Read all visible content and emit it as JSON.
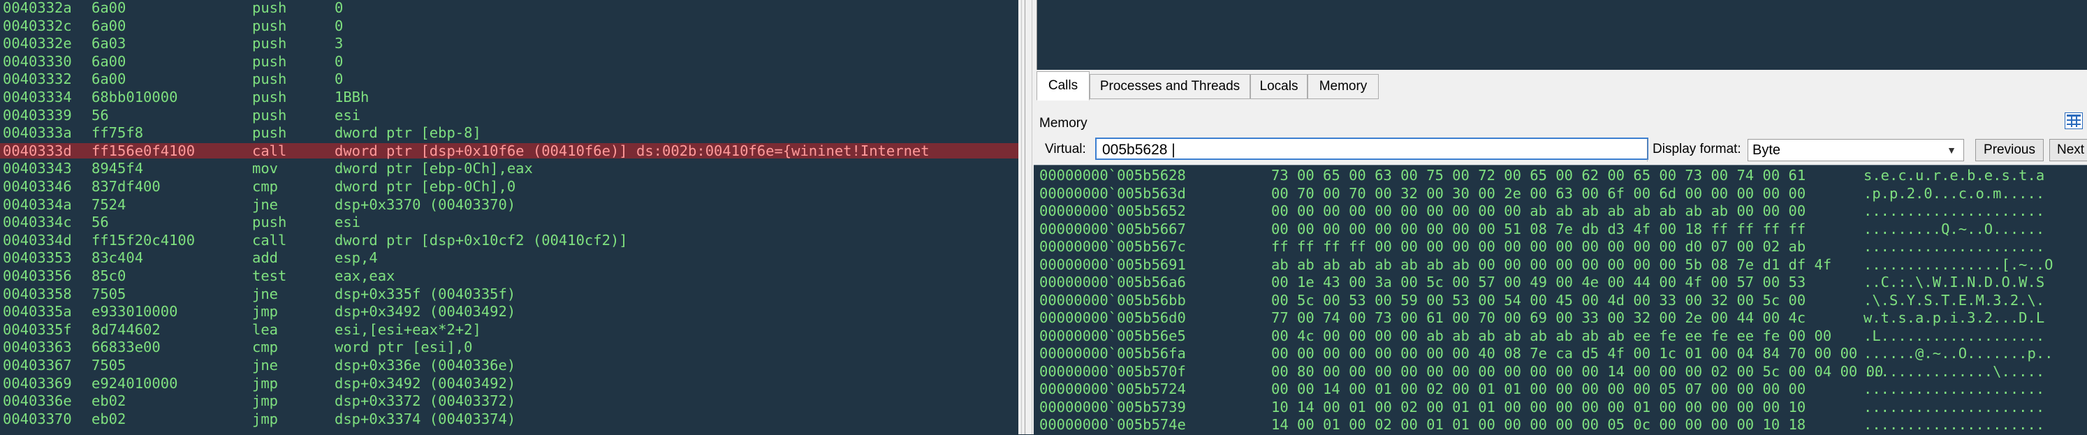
{
  "disassembly": {
    "rows": [
      {
        "addr": "0040332a",
        "bytes": "6a00",
        "mnemonic": "push",
        "operands": "0"
      },
      {
        "addr": "0040332c",
        "bytes": "6a00",
        "mnemonic": "push",
        "operands": "0"
      },
      {
        "addr": "0040332e",
        "bytes": "6a03",
        "mnemonic": "push",
        "operands": "3"
      },
      {
        "addr": "00403330",
        "bytes": "6a00",
        "mnemonic": "push",
        "operands": "0"
      },
      {
        "addr": "00403332",
        "bytes": "6a00",
        "mnemonic": "push",
        "operands": "0"
      },
      {
        "addr": "00403334",
        "bytes": "68bb010000",
        "mnemonic": "push",
        "operands": "1BBh"
      },
      {
        "addr": "00403339",
        "bytes": "56",
        "mnemonic": "push",
        "operands": "esi"
      },
      {
        "addr": "0040333a",
        "bytes": "ff75f8",
        "mnemonic": "push",
        "operands": "dword ptr [ebp-8]"
      },
      {
        "addr": "0040333d",
        "bytes": "ff156e0f4100",
        "mnemonic": "call",
        "operands": "dword ptr [dsp+0x10f6e (00410f6e)] ds:002b:00410f6e={wininet!Internet",
        "highlighted": true
      },
      {
        "addr": "00403343",
        "bytes": "8945f4",
        "mnemonic": "mov",
        "operands": "dword ptr [ebp-0Ch],eax"
      },
      {
        "addr": "00403346",
        "bytes": "837df400",
        "mnemonic": "cmp",
        "operands": "dword ptr [ebp-0Ch],0"
      },
      {
        "addr": "0040334a",
        "bytes": "7524",
        "mnemonic": "jne",
        "operands": "dsp+0x3370 (00403370)"
      },
      {
        "addr": "0040334c",
        "bytes": "56",
        "mnemonic": "push",
        "operands": "esi"
      },
      {
        "addr": "0040334d",
        "bytes": "ff15f20c4100",
        "mnemonic": "call",
        "operands": "dword ptr [dsp+0x10cf2 (00410cf2)]"
      },
      {
        "addr": "00403353",
        "bytes": "83c404",
        "mnemonic": "add",
        "operands": "esp,4"
      },
      {
        "addr": "00403356",
        "bytes": "85c0",
        "mnemonic": "test",
        "operands": "eax,eax"
      },
      {
        "addr": "00403358",
        "bytes": "7505",
        "mnemonic": "jne",
        "operands": "dsp+0x335f (0040335f)"
      },
      {
        "addr": "0040335a",
        "bytes": "e933010000",
        "mnemonic": "jmp",
        "operands": "dsp+0x3492 (00403492)"
      },
      {
        "addr": "0040335f",
        "bytes": "8d744602",
        "mnemonic": "lea",
        "operands": "esi,[esi+eax*2+2]"
      },
      {
        "addr": "00403363",
        "bytes": "66833e00",
        "mnemonic": "cmp",
        "operands": "word ptr [esi],0"
      },
      {
        "addr": "00403367",
        "bytes": "7505",
        "mnemonic": "jne",
        "operands": "dsp+0x336e (0040336e)"
      },
      {
        "addr": "00403369",
        "bytes": "e924010000",
        "mnemonic": "jmp",
        "operands": "dsp+0x3492 (00403492)"
      },
      {
        "addr": "0040336e",
        "bytes": "eb02",
        "mnemonic": "jmp",
        "operands": "dsp+0x3372 (00403372)"
      },
      {
        "addr": "00403370",
        "bytes": "eb02",
        "mnemonic": "jmp",
        "operands": "dsp+0x3374 (00403374)"
      }
    ]
  },
  "tabs": [
    {
      "label": "Calls",
      "active": true
    },
    {
      "label": "Processes and Threads",
      "active": false
    },
    {
      "label": "Locals",
      "active": false
    },
    {
      "label": "Memory",
      "active": false
    }
  ],
  "memory": {
    "title": "Memory",
    "virtual_label": "Virtual:",
    "virtual_value": "005b5628 |",
    "display_format_label": "Display format:",
    "display_format_value": "Byte",
    "previous_label": "Previous",
    "next_label": "Next",
    "rows": [
      {
        "addr": "00000000`005b5628",
        "hex": "73 00 65 00 63 00 75 00 72 00 65 00 62 00 65 00 73 00 74 00 61",
        "ascii": "s.e.c.u.r.e.b.e.s.t.a"
      },
      {
        "addr": "00000000`005b563d",
        "hex": "00 70 00 70 00 32 00 30 00 2e 00 63 00 6f 00 6d 00 00 00 00 00",
        "ascii": ".p.p.2.0...c.o.m....."
      },
      {
        "addr": "00000000`005b5652",
        "hex": "00 00 00 00 00 00 00 00 00 00 ab ab ab ab ab ab ab ab 00 00 00",
        "ascii": "....................."
      },
      {
        "addr": "00000000`005b5667",
        "hex": "00 00 00 00 00 00 00 00 00 51 08 7e db d3 4f 00 18 ff ff ff ff",
        "ascii": ".........Q.~..O......"
      },
      {
        "addr": "00000000`005b567c",
        "hex": "ff ff ff ff 00 00 00 00 00 00 00 00 00 00 00 00 d0 07 00 02 ab",
        "ascii": "....................."
      },
      {
        "addr": "00000000`005b5691",
        "hex": "ab ab ab ab ab ab ab ab 00 00 00 00 00 00 00 00 5b 08 7e d1 df 4f",
        "ascii": "................[.~..O"
      },
      {
        "addr": "00000000`005b56a6",
        "hex": "00 1e 43 00 3a 00 5c 00 57 00 49 00 4e 00 44 00 4f 00 57 00 53",
        "ascii": "..C.:.\\.W.I.N.D.O.W.S"
      },
      {
        "addr": "00000000`005b56bb",
        "hex": "00 5c 00 53 00 59 00 53 00 54 00 45 00 4d 00 33 00 32 00 5c 00",
        "ascii": ".\\.S.Y.S.T.E.M.3.2.\\."
      },
      {
        "addr": "00000000`005b56d0",
        "hex": "77 00 74 00 73 00 61 00 70 00 69 00 33 00 32 00 2e 00 44 00 4c",
        "ascii": "w.t.s.a.p.i.3.2...D.L"
      },
      {
        "addr": "00000000`005b56e5",
        "hex": "00 4c 00 00 00 00 ab ab ab ab ab ab ab ab ee fe ee fe ee fe 00 00",
        "ascii": ".L..................."
      },
      {
        "addr": "00000000`005b56fa",
        "hex": "00 00 00 00 00 00 00 00 40 08 7e ca d5 4f 00 1c 01 00 04 84 70 00 00",
        "ascii": "......@.~..O.......p.."
      },
      {
        "addr": "00000000`005b570f",
        "hex": "00 80 00 00 00 00 00 00 00 00 00 00 00 14 00 00 00 02 00 5c 00 04 00 00",
        "ascii": "...............\\....."
      },
      {
        "addr": "00000000`005b5724",
        "hex": "00 00 14 00 01 00 02 00 01 01 00 00 00 00 00 05 07 00 00 00 00",
        "ascii": "....................."
      },
      {
        "addr": "00000000`005b5739",
        "hex": "10 14 00 01 00 02 00 01 01 00 00 00 00 00 01 00 00 00 00 00 10",
        "ascii": "....................."
      },
      {
        "addr": "00000000`005b574e",
        "hex": "14 00 01 00 02 00 01 01 00 00 00 00 00 05 0c 00 00 00 00 10 18",
        "ascii": "....................."
      }
    ]
  },
  "icons": {
    "layout_grid": "grid-icon"
  }
}
